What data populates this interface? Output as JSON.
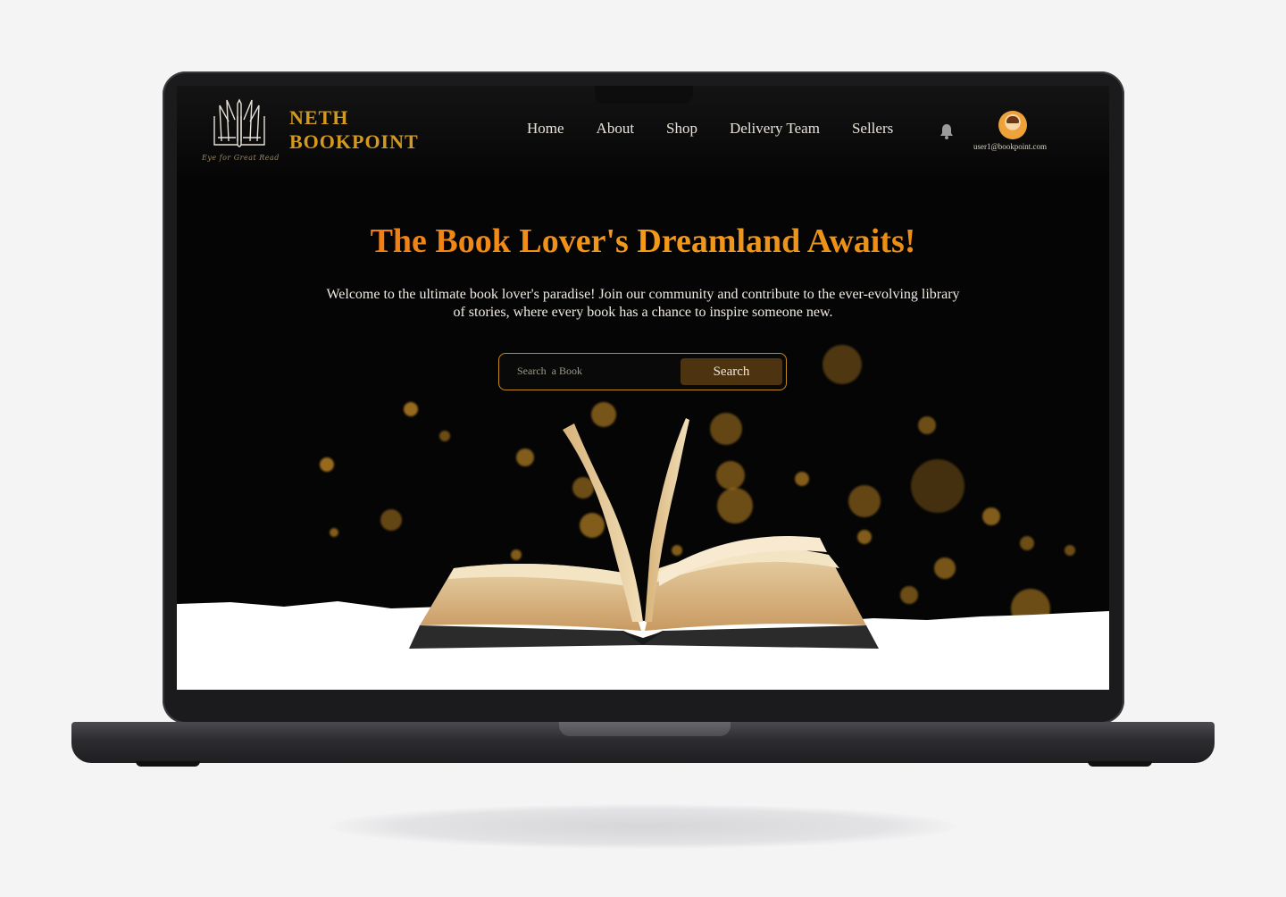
{
  "brand": {
    "line1": "NETH",
    "line2": "BOOKPOINT",
    "tagline": "Eye for Great Read"
  },
  "nav": {
    "items": [
      "Home",
      "About",
      "Shop",
      "Delivery Team",
      "Sellers"
    ]
  },
  "user": {
    "email": "user1@bookpoint.com"
  },
  "hero": {
    "title": "The Book Lover's Dreamland Awaits!",
    "subtitle": "Welcome to the ultimate book lover's paradise! Join our community and contribute to the ever-evolving library of stories, where every book has a chance to inspire someone new."
  },
  "search": {
    "placeholder": "Search  a Book",
    "button_label": "Search"
  },
  "colors": {
    "accent": "#d49a1f",
    "title": "#ee7a12",
    "button": "#4e3311",
    "background": "#050505"
  },
  "icons": [
    "book-logo-icon",
    "bell-icon",
    "avatar"
  ]
}
